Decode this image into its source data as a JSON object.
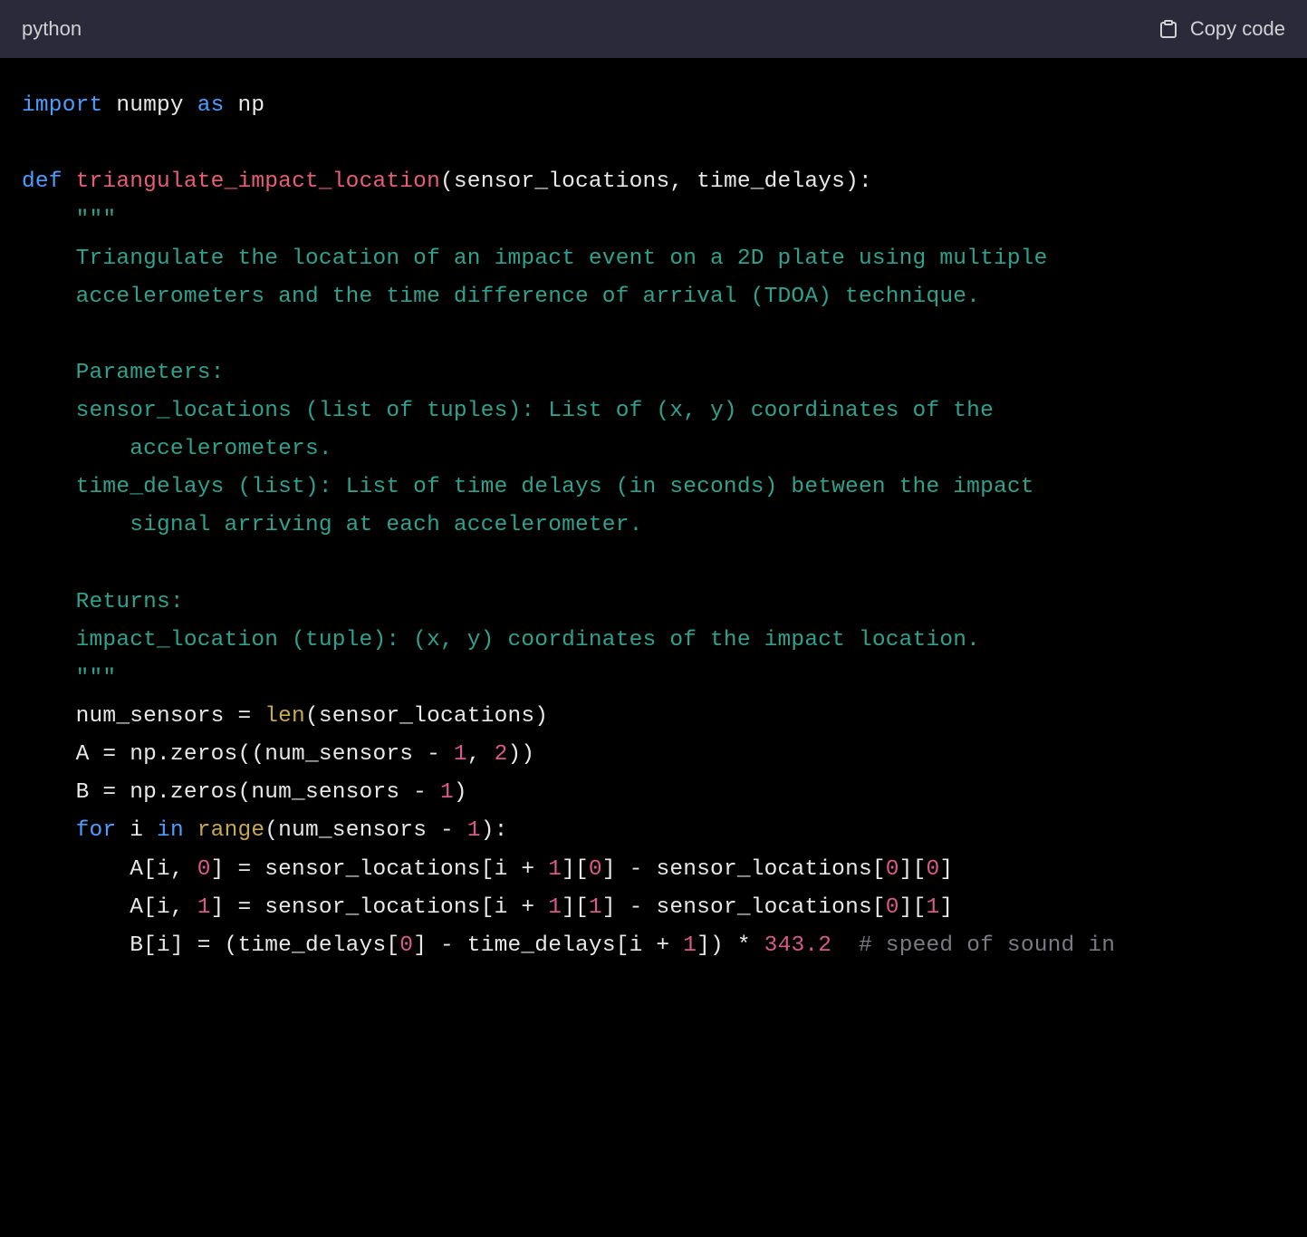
{
  "header": {
    "language": "python",
    "copy_label": "Copy code"
  },
  "code": {
    "l1_import": "import",
    "l1_numpy": " numpy ",
    "l1_as": "as",
    "l1_np": " np",
    "l2_blank": "",
    "l3_def": "def",
    "l3_sp": " ",
    "l3_fn": "triangulate_impact_location",
    "l3_params": "(sensor_locations, time_delays):",
    "l4_docq": "    \"\"\"",
    "l5": "    Triangulate the location of an impact event on a 2D plate using multiple",
    "l6": "    accelerometers and the time difference of arrival (TDOA) technique.",
    "l7_blank": "",
    "l8": "    Parameters:",
    "l9": "    sensor_locations (list of tuples): List of (x, y) coordinates of the ",
    "l10": "        accelerometers.",
    "l11": "    time_delays (list): List of time delays (in seconds) between the impact ",
    "l12": "        signal arriving at each accelerometer.",
    "l13_blank": "",
    "l14": "    Returns:",
    "l15": "    impact_location (tuple): (x, y) coordinates of the impact location.",
    "l16_docq": "    \"\"\"",
    "l17_a": "    num_sensors = ",
    "l17_len": "len",
    "l17_b": "(sensor_locations)",
    "l18_a": "    A = np.zeros((num_sensors - ",
    "l18_n1": "1",
    "l18_b": ", ",
    "l18_n2": "2",
    "l18_c": "))",
    "l19_a": "    B = np.zeros(num_sensors - ",
    "l19_n1": "1",
    "l19_b": ")",
    "l20_for": "    for",
    "l20_a": " i ",
    "l20_in": "in",
    "l20_sp": " ",
    "l20_range": "range",
    "l20_b": "(num_sensors - ",
    "l20_n1": "1",
    "l20_c": "):",
    "l21_a": "        A[i, ",
    "l21_n0a": "0",
    "l21_b": "] = sensor_locations[i + ",
    "l21_n1": "1",
    "l21_c": "][",
    "l21_n0b": "0",
    "l21_d": "] - sensor_locations[",
    "l21_n0c": "0",
    "l21_e": "][",
    "l21_n0d": "0",
    "l21_f": "]",
    "l22_a": "        A[i, ",
    "l22_n1a": "1",
    "l22_b": "] = sensor_locations[i + ",
    "l22_n1b": "1",
    "l22_c": "][",
    "l22_n1c": "1",
    "l22_d": "] - sensor_locations[",
    "l22_n0": "0",
    "l22_e": "][",
    "l22_n1d": "1",
    "l22_f": "]",
    "l23_a": "        B[i] = (time_delays[",
    "l23_n0": "0",
    "l23_b": "] - time_delays[i + ",
    "l23_n1": "1",
    "l23_c": "]) * ",
    "l23_speed": "343.2",
    "l23_sp": "  ",
    "l23_comment": "# speed of sound in"
  }
}
